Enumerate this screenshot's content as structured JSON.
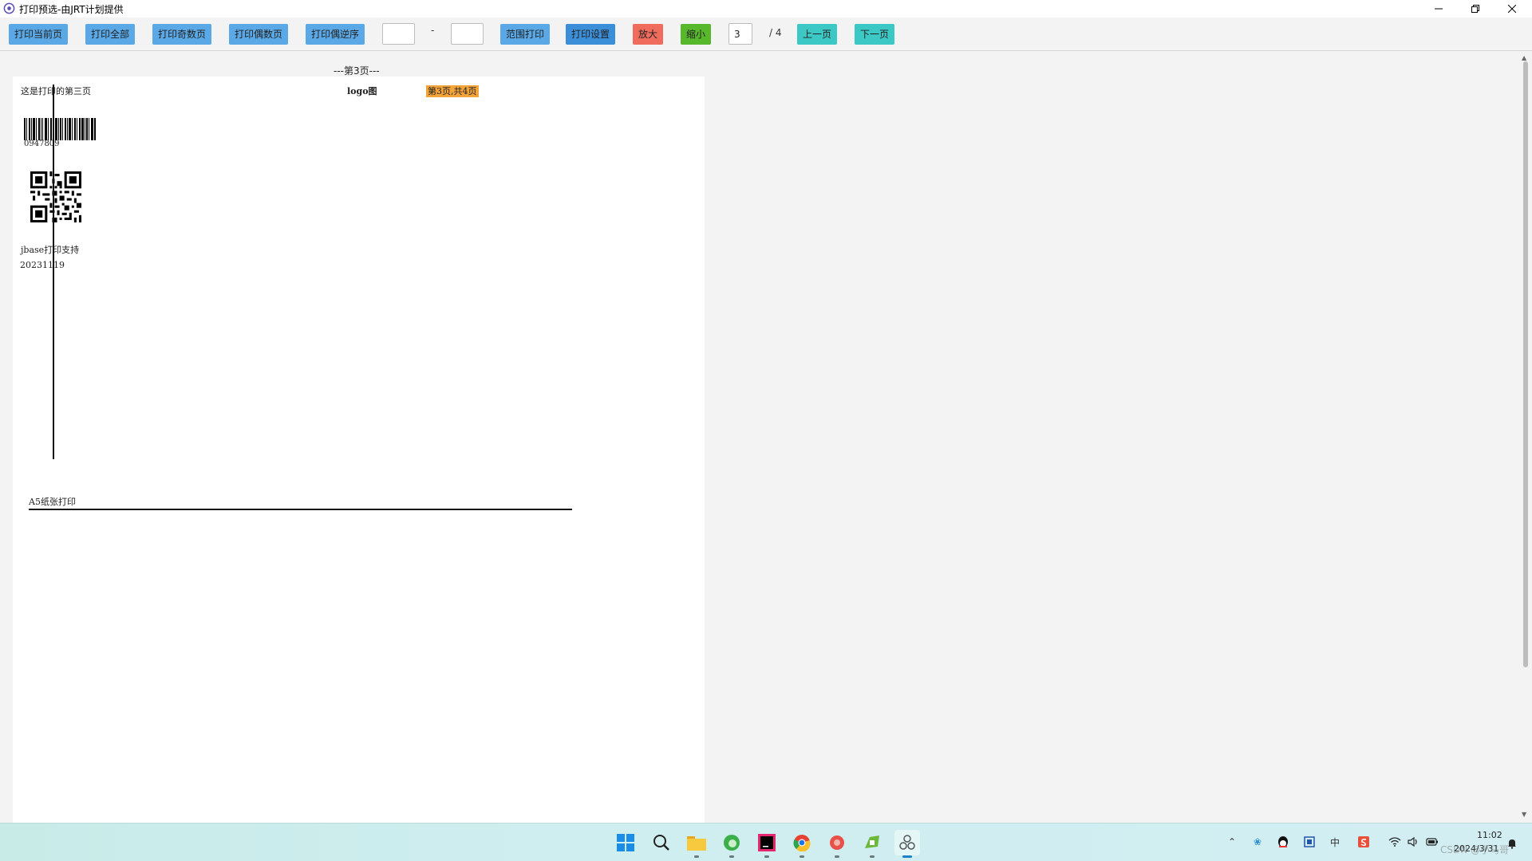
{
  "window": {
    "title": "打印预选-由JRT计划提供"
  },
  "toolbar": {
    "print_current": "打印当前页",
    "print_all": "打印全部",
    "print_odd": "打印奇数页",
    "print_even": "打印偶数页",
    "print_even_reverse": "打印偶逆序",
    "range_separator": "-",
    "range_print": "范围打印",
    "print_settings": "打印设置",
    "zoom_in": "放大",
    "zoom_out": "缩小",
    "current_page": "3",
    "total_pages": "/ 4",
    "prev_page": "上一页",
    "next_page": "下一页",
    "range_from": "",
    "range_to": ""
  },
  "colors": {
    "blue_button": "#5aa9e6",
    "dark_blue_button": "#3b8fd9",
    "red_button": "#f06c5d",
    "green_button": "#58b82b",
    "teal_button": "#3cc8c4",
    "label_highlight": "#f2a33a"
  },
  "document": {
    "page_heading": "---第3页---",
    "page_content": {
      "intro_text": "这是打印的第三页",
      "logo_label": "logo图",
      "page_counter": "第3页,共4页",
      "barcode_number": "0947809",
      "support_text": "jbase打印支持",
      "date_text": "20231119",
      "paper_label": "A5纸张打印"
    }
  },
  "taskbar": {
    "icons": [
      "windows-start-icon",
      "search-icon",
      "file-explorer-icon",
      "edge-browser-icon",
      "intellij-idea-icon",
      "chrome-browser-icon",
      "red-app-icon",
      "green-app-icon",
      "jrt-print-app-icon"
    ]
  },
  "tray": {
    "time": "11:02",
    "date": "2024/3/31",
    "watermark": "CSDN @小马哥"
  }
}
